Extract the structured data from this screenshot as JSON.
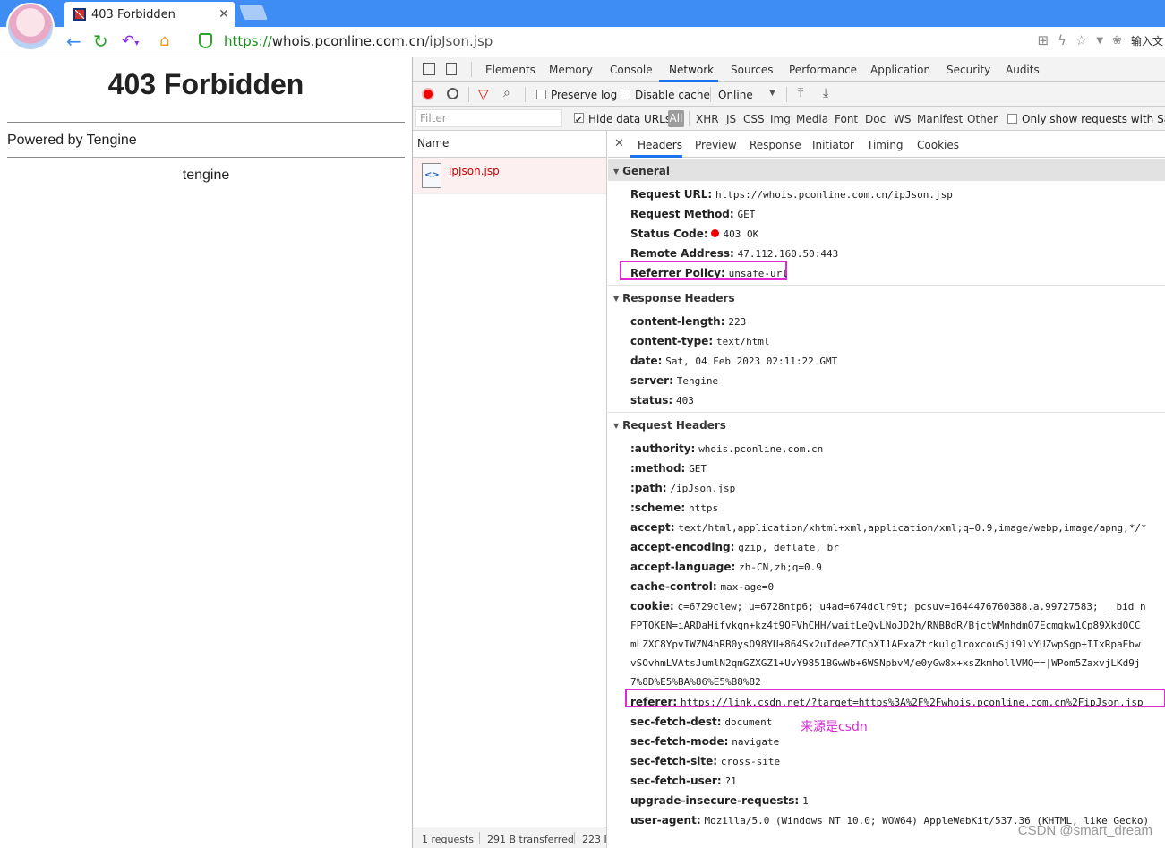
{
  "browser": {
    "tab_title": "403 Forbidden",
    "url_scheme": "https://",
    "url_host": "whois.pconline.com.cn",
    "url_path": "/ipJson.jsp",
    "ime_label": "输入文"
  },
  "page": {
    "heading": "403 Forbidden",
    "powered": "Powered by Tengine",
    "footer": "tengine"
  },
  "devtools": {
    "tabs": [
      "Elements",
      "Memory",
      "Console",
      "Network",
      "Sources",
      "Performance",
      "Application",
      "Security",
      "Audits"
    ],
    "active_tab": "Network",
    "toolbar": {
      "preserve_log": "Preserve log",
      "disable_cache": "Disable cache",
      "throttle": "Online"
    },
    "filter": {
      "placeholder": "Filter",
      "hide_data_urls": "Hide data URLs",
      "types": [
        "All",
        "XHR",
        "JS",
        "CSS",
        "Img",
        "Media",
        "Font",
        "Doc",
        "WS",
        "Manifest",
        "Other"
      ],
      "only_same": "Only show requests with Same"
    },
    "list": {
      "name_header": "Name",
      "rows": [
        "ipJson.jsp"
      ],
      "status": {
        "requests": "1 requests",
        "transferred": "291 B transferred",
        "size": "223 I"
      }
    },
    "detail": {
      "subtabs": [
        "Headers",
        "Preview",
        "Response",
        "Initiator",
        "Timing",
        "Cookies"
      ],
      "general_title": "General",
      "general": [
        {
          "k": "Request URL:",
          "v": "https://whois.pconline.com.cn/ipJson.jsp"
        },
        {
          "k": "Request Method:",
          "v": "GET"
        },
        {
          "k": "Status Code:",
          "v": "403 OK"
        },
        {
          "k": "Remote Address:",
          "v": "47.112.160.50:443"
        },
        {
          "k": "Referrer Policy:",
          "v": "unsafe-url"
        }
      ],
      "response_title": "Response Headers",
      "response": [
        {
          "k": "content-length:",
          "v": "223"
        },
        {
          "k": "content-type:",
          "v": "text/html"
        },
        {
          "k": "date:",
          "v": "Sat, 04 Feb 2023 02:11:22 GMT"
        },
        {
          "k": "server:",
          "v": "Tengine"
        },
        {
          "k": "status:",
          "v": "403"
        }
      ],
      "request_title": "Request Headers",
      "request": [
        {
          "k": ":authority:",
          "v": "whois.pconline.com.cn"
        },
        {
          "k": ":method:",
          "v": "GET"
        },
        {
          "k": ":path:",
          "v": "/ipJson.jsp"
        },
        {
          "k": ":scheme:",
          "v": "https"
        },
        {
          "k": "accept:",
          "v": "text/html,application/xhtml+xml,application/xml;q=0.9,image/webp,image/apng,*/*"
        },
        {
          "k": "accept-encoding:",
          "v": "gzip, deflate, br"
        },
        {
          "k": "accept-language:",
          "v": "zh-CN,zh;q=0.9"
        },
        {
          "k": "cache-control:",
          "v": "max-age=0"
        },
        {
          "k": "cookie:",
          "v": "c=6729clew; u=6728ntp6; u4ad=674dclr9t; pcsuv=1644476760388.a.99727583; __bid_n"
        }
      ],
      "cookie_cont": [
        "FPTOKEN=iARDaHifvkqn+kz4t9OFVhCHH/waitLeQvLNoJD2h/RNBBdR/BjctWMnhdmO7Ecmqkw1Cp89XkdOCC",
        "mLZXC8YpvIWZN4hRB0ysO98YU+864Sx2uIdeeZTCpXI1AExaZtrkulg1roxcouSji9lvYUZwpSgp+IIxRpaEbw",
        "vSOvhmLVAtsJumlN2qmGZXGZ1+UvY9851BGwWb+6WSNpbvM/e0yGw8x+xsZkmhollVMQ==|WPom5ZaxvjLKd9j",
        "7%8D%E5%BA%86%E5%B8%82"
      ],
      "referer": {
        "k": "referer:",
        "v": "https://link.csdn.net/?target=https%3A%2F%2Fwhois.pconline.com.cn%2FipJson.jsp"
      },
      "request_after": [
        {
          "k": "sec-fetch-dest:",
          "v": "document"
        },
        {
          "k": "sec-fetch-mode:",
          "v": "navigate"
        },
        {
          "k": "sec-fetch-site:",
          "v": "cross-site"
        },
        {
          "k": "sec-fetch-user:",
          "v": "?1"
        },
        {
          "k": "upgrade-insecure-requests:",
          "v": "1"
        },
        {
          "k": "user-agent:",
          "v": "Mozilla/5.0 (Windows NT 10.0; WOW64) AppleWebKit/537.36 (KHTML, like Gecko)"
        }
      ]
    }
  },
  "annotation": "来源是csdn",
  "watermark": "CSDN @smart_dream",
  "colors": {
    "chrome_blue": "#3d8df5",
    "highlight": "#e02ad1",
    "status_red": "#ee0000",
    "link_red": "#cc0000"
  },
  "icons": [
    "back-arrow-icon",
    "reload-icon",
    "undo-icon",
    "home-icon",
    "shield-icon",
    "qr-icon",
    "bolt-icon",
    "star-icon",
    "record-icon",
    "clear-icon",
    "filter-icon",
    "search-icon",
    "upload-icon",
    "download-icon",
    "document-icon",
    "close-icon"
  ]
}
